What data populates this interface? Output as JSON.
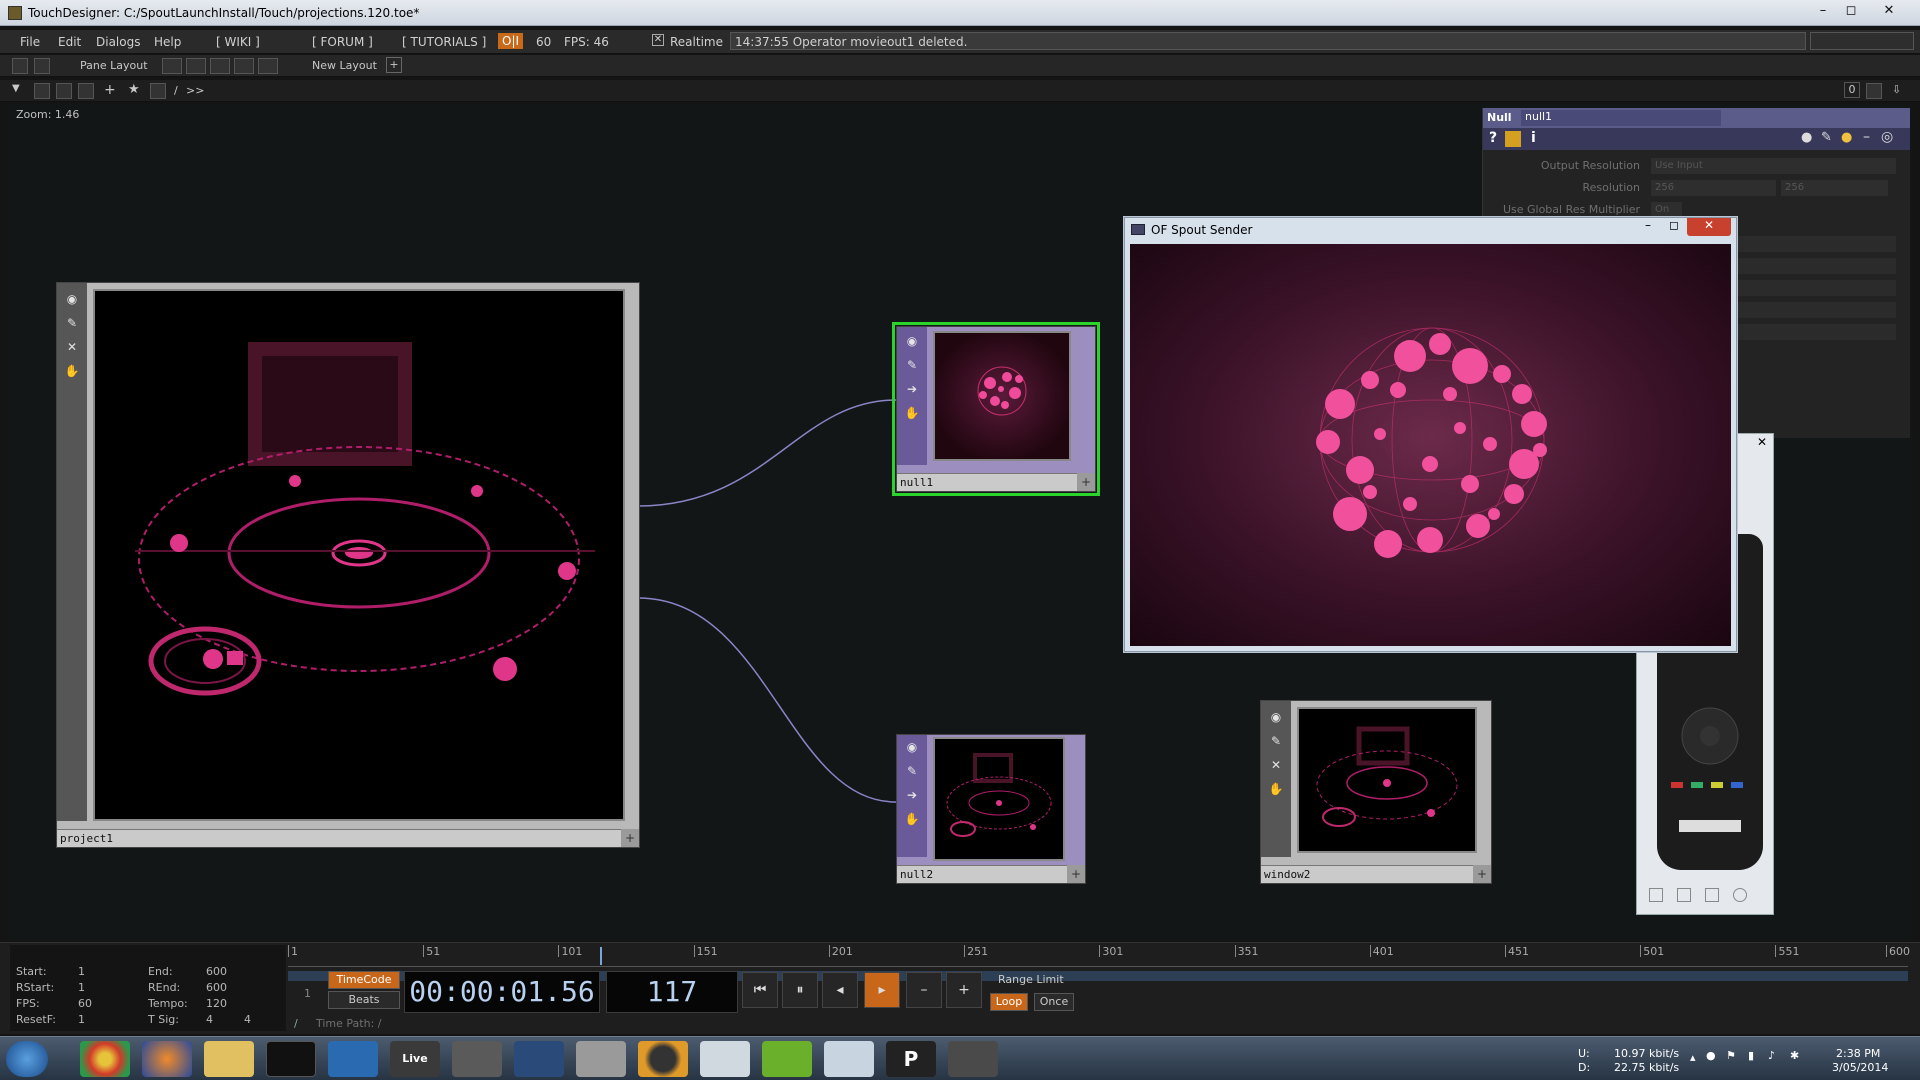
{
  "window": {
    "title": "TouchDesigner: C:/SpoutLaunchInstall/Touch/projections.120.toe*",
    "controls": [
      "–",
      "◻",
      "✕"
    ]
  },
  "menubar": {
    "items": [
      "File",
      "Edit",
      "Dialogs",
      "Help"
    ],
    "links": [
      "[ WIKI ]",
      "[ FORUM ]",
      "[ TUTORIALS ]"
    ],
    "oi": "O|I",
    "fps_target": "60",
    "fps": "FPS: 46",
    "realtime": "Realtime",
    "status": "14:37:55 Operator movieout1 deleted."
  },
  "toolbar": {
    "pane_layout": "Pane Layout",
    "new_layout": "New Layout",
    "plus": "+",
    "path": "/",
    "more": ">>",
    "right_value": "0"
  },
  "network": {
    "zoom": "Zoom: 1.46",
    "operators": [
      {
        "id": "project1",
        "label": "project1"
      },
      {
        "id": "null1",
        "label": "null1"
      },
      {
        "id": "null2",
        "label": "null2"
      },
      {
        "id": "window2",
        "label": "window2"
      }
    ]
  },
  "params": {
    "type": "Null",
    "name": "null1",
    "rows": [
      {
        "label": "Output Resolution",
        "value": "Use Input"
      },
      {
        "label": "Resolution",
        "value": "256"
      },
      {
        "label": "Use Global Res Multiplier",
        "value": "On"
      }
    ]
  },
  "sender": {
    "title": "OF Spout Sender",
    "controls": [
      "–",
      "◻",
      "✕"
    ]
  },
  "timeline": {
    "info": {
      "start_label": "Start:",
      "start": "1",
      "end_label": "End:",
      "end": "600",
      "rstart_label": "RStart:",
      "rstart": "1",
      "rend_label": "REnd:",
      "rend": "600",
      "fps_label": "FPS:",
      "fps": "60",
      "tempo_label": "Tempo:",
      "tempo": "120",
      "resetf_label": "ResetF:",
      "resetf": "1",
      "tsig_label": "T Sig:",
      "tsig_a": "4",
      "tsig_b": "4"
    },
    "ticks": [
      "1",
      "51",
      "101",
      "151",
      "201",
      "251",
      "301",
      "351",
      "401",
      "451",
      "501",
      "551",
      "600"
    ],
    "timecode_label": "TimeCode",
    "beats_label": "Beats",
    "timecode": "00:00:01.56",
    "frame": "117",
    "range_limit": "Range Limit",
    "loop": "Loop",
    "once": "Once",
    "time_path": "Time Path: /",
    "one": "1",
    "slash": "/"
  },
  "taskbar": {
    "live_label": "Live",
    "net_u_label": "U:",
    "net_u": "10.97 kbit/s",
    "net_d_label": "D:",
    "net_d": "22.75 kbit/s",
    "time": "2:38 PM",
    "date": "3/05/2014"
  }
}
